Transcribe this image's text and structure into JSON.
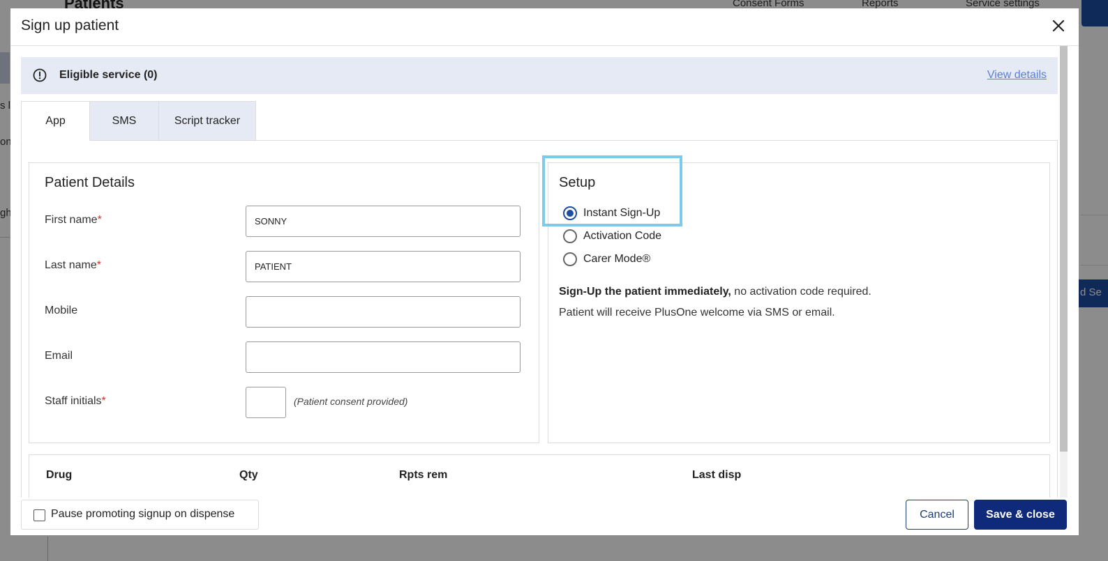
{
  "background": {
    "page_title": "Patients",
    "nav": [
      "Consent Forms",
      "Reports",
      "Service settings"
    ],
    "side_fragments": [
      "s l",
      "ons",
      "ght"
    ],
    "right_button_fragment": "d Se"
  },
  "modal": {
    "title": "Sign up patient",
    "close_icon": "close-icon",
    "banner": {
      "icon": "alert-circle-icon",
      "text": "Eligible service (0)",
      "link": "View details"
    },
    "tabs": [
      {
        "label": "App",
        "active": true
      },
      {
        "label": "SMS",
        "active": false
      },
      {
        "label": "Script tracker",
        "active": false
      }
    ],
    "patient_details": {
      "title": "Patient Details",
      "fields": {
        "first_name": {
          "label": "First name",
          "required": "*",
          "value": "SONNY"
        },
        "last_name": {
          "label": "Last name",
          "required": "*",
          "value": "PATIENT"
        },
        "mobile": {
          "label": "Mobile",
          "value": ""
        },
        "email": {
          "label": "Email",
          "value": ""
        },
        "staff_initials": {
          "label": "Staff initials",
          "required": "*",
          "value": "",
          "note": "(Patient consent provided)"
        }
      }
    },
    "setup": {
      "title": "Setup",
      "options": [
        {
          "label": "Instant Sign-Up",
          "selected": true
        },
        {
          "label": "Activation Code",
          "selected": false
        },
        {
          "label": "Carer Mode®",
          "selected": false
        }
      ],
      "desc_bold": "Sign-Up the patient immediately,",
      "desc_rest": " no activation code required.",
      "desc_line2": "Patient will receive PlusOne welcome via SMS or email."
    },
    "drug_table": {
      "columns": [
        "Drug",
        "Qty",
        "Rpts rem",
        "Last disp"
      ]
    },
    "footer": {
      "pause_label": "Pause promoting signup on dispense",
      "pause_checked": false,
      "cancel": "Cancel",
      "save": "Save & close"
    }
  },
  "colors": {
    "primary": "#0f2a7a",
    "radio_selected": "#1d4ea0",
    "banner_bg": "#e6eaf4",
    "highlight": "#7ccbef",
    "link": "#5b7fd1",
    "required": "#d0312d"
  }
}
